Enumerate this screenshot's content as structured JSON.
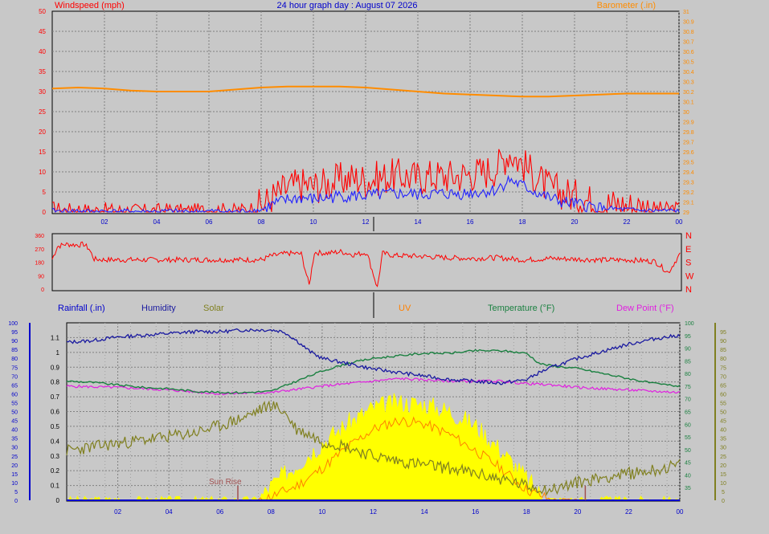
{
  "title": "24 hour graph day : August 07 2026",
  "colors": {
    "background": "#c8c8c8",
    "wind_speed": "#ff0000",
    "wind_avg": "#2222ff",
    "barometer": "#ff8c00",
    "direction": "#ff0000",
    "rainfall": "#0000cc",
    "humidity": "#1a1aa0",
    "solar": "#808020",
    "solar_fill": "#ffff00",
    "uv": "#ff8000",
    "temperature": "#1a8040",
    "dew_point": "#e020e0",
    "sun_marker": "#a05050",
    "x_ticks": "#0000cc"
  },
  "sun": {
    "rise_label": "Sun Rise",
    "rise_hour": 6.7,
    "set_hour": 20.3
  },
  "chart_data": [
    {
      "type": "line",
      "name": "wind-barometer",
      "title": "24 hour graph day : August 07 2026",
      "ylabel": "Windspeed (mph)",
      "y2label": "Barometer (.in)",
      "ylim": [
        0,
        50
      ],
      "y2lim": [
        29.0,
        31.0
      ],
      "x_ticks": [
        "02",
        "04",
        "06",
        "08",
        "10",
        "12",
        "14",
        "16",
        "18",
        "20",
        "22",
        "00"
      ],
      "x_range": [
        0,
        24
      ],
      "y_ticks": [
        "0",
        "5",
        "10",
        "15",
        "20",
        "25",
        "30",
        "35",
        "40",
        "45",
        "50"
      ],
      "y2_ticks": [
        "29",
        "29.1",
        "29.2",
        "29.3",
        "29.4",
        "29.5",
        "29.6",
        "29.7",
        "29.8",
        "29.9",
        "30",
        "30.1",
        "30.2",
        "30.3",
        "30.4",
        "30.5",
        "30.6",
        "30.7",
        "30.8",
        "30.9",
        "31"
      ],
      "grid": true,
      "series": [
        {
          "name": "Windspeed",
          "x": [
            0,
            0.5,
            1,
            1.5,
            2,
            2.5,
            3,
            3.5,
            4,
            4.5,
            5,
            5.5,
            6,
            6.5,
            7,
            7.5,
            8,
            8.5,
            9,
            9.5,
            10,
            10.5,
            11,
            11.5,
            12,
            12.5,
            13,
            13.5,
            14,
            14.5,
            15,
            15.5,
            16,
            16.5,
            17,
            17.5,
            18,
            18.5,
            19,
            19.5,
            20,
            20.5,
            21,
            21.5,
            22,
            22.5,
            23,
            23.5,
            24
          ],
          "y": [
            1,
            0.5,
            0.8,
            0.3,
            0.6,
            0.4,
            0.5,
            0.3,
            0.4,
            0.6,
            0.3,
            0.4,
            0.5,
            0.6,
            0.4,
            0.8,
            1.5,
            4,
            6,
            7,
            6.5,
            7,
            8,
            8.5,
            8,
            8.5,
            9,
            9,
            8.5,
            9,
            9,
            9,
            9.5,
            10,
            11,
            15,
            12,
            9,
            6,
            5,
            4,
            3,
            2,
            2,
            1.5,
            1.2,
            1,
            0.8,
            1
          ]
        },
        {
          "name": "Wind Average",
          "x": [
            0,
            0.5,
            1,
            1.5,
            2,
            2.5,
            3,
            3.5,
            4,
            4.5,
            5,
            5.5,
            6,
            6.5,
            7,
            7.5,
            8,
            8.5,
            9,
            9.5,
            10,
            10.5,
            11,
            11.5,
            12,
            12.5,
            13,
            13.5,
            14,
            14.5,
            15,
            15.5,
            16,
            16.5,
            17,
            17.5,
            18,
            18.5,
            19,
            19.5,
            20,
            20.5,
            21,
            21.5,
            22,
            22.5,
            23,
            23.5,
            24
          ],
          "y": [
            0.3,
            0.2,
            0.3,
            0.1,
            0.2,
            0.1,
            0.2,
            0.1,
            0.1,
            0.2,
            0.1,
            0.1,
            0.2,
            0.2,
            0.1,
            0.3,
            0.5,
            2,
            3,
            3.5,
            3.2,
            3.5,
            4,
            4,
            4,
            4.2,
            4.5,
            4.5,
            4.3,
            4.5,
            4.5,
            4.5,
            4.8,
            5,
            5.5,
            8,
            6.5,
            5,
            3.5,
            2.5,
            2,
            1.5,
            1,
            0.8,
            0.6,
            0.4,
            0.3,
            0.3,
            0.3
          ]
        },
        {
          "name": "Barometer",
          "axis": "right",
          "x": [
            0,
            1,
            2,
            3,
            4,
            5,
            6,
            7,
            8,
            9,
            10,
            11,
            12,
            13,
            14,
            15,
            16,
            17,
            18,
            19,
            20,
            21,
            22,
            23,
            24
          ],
          "y": [
            30.23,
            30.24,
            30.23,
            30.21,
            30.2,
            30.2,
            30.2,
            30.22,
            30.24,
            30.25,
            30.25,
            30.25,
            30.24,
            30.22,
            30.2,
            30.18,
            30.17,
            30.16,
            30.15,
            30.15,
            30.16,
            30.17,
            30.18,
            30.18,
            30.18
          ]
        }
      ]
    },
    {
      "type": "line",
      "name": "wind-direction",
      "ylim": [
        0,
        360
      ],
      "y_ticks": [
        "0",
        "90",
        "180",
        "270",
        "360"
      ],
      "direction_labels": [
        "N",
        "W",
        "S",
        "E",
        "N"
      ],
      "x_range": [
        0,
        24
      ],
      "grid": false,
      "series": [
        {
          "name": "Wind Direction",
          "x": [
            0,
            0.2,
            0.5,
            1,
            1.2,
            1.4,
            1.6,
            2,
            4,
            6,
            8,
            8.3,
            9,
            9.5,
            9.8,
            10,
            10.5,
            11,
            11.5,
            12,
            12.4,
            12.6,
            13,
            14,
            15,
            16,
            17,
            18,
            19,
            20,
            21,
            22,
            23,
            23.5,
            24
          ],
          "y": [
            200,
            285,
            300,
            295,
            300,
            270,
            200,
            196,
            196,
            196,
            196,
            220,
            240,
            235,
            25,
            245,
            240,
            250,
            230,
            245,
            10,
            240,
            225,
            220,
            210,
            205,
            210,
            195,
            205,
            200,
            195,
            195,
            185,
            110,
            250
          ]
        }
      ]
    },
    {
      "type": "line",
      "name": "weather-combo",
      "labels": [
        "Rainfall (.in)",
        "Humidity",
        "Solar",
        "UV",
        "Temperature (°F)",
        "Dew Point (°F)"
      ],
      "x_ticks": [
        "02",
        "04",
        "06",
        "08",
        "10",
        "12",
        "14",
        "16",
        "18",
        "20",
        "22",
        "00"
      ],
      "x_range": [
        0,
        24
      ],
      "rain_ticks": [
        "0",
        "0.1",
        "0.2",
        "0.3",
        "0.4",
        "0.5",
        "0.6",
        "0.7",
        "0.8",
        "0.9",
        "1",
        "1.1"
      ],
      "rain_lim": [
        0,
        1.2
      ],
      "hum_ticks": [
        "0",
        "5",
        "10",
        "15",
        "20",
        "25",
        "30",
        "35",
        "40",
        "45",
        "50",
        "55",
        "60",
        "65",
        "70",
        "75",
        "80",
        "85",
        "90",
        "95",
        "100"
      ],
      "hum_lim": [
        0,
        100
      ],
      "temp_ticks": [
        "35",
        "40",
        "45",
        "50",
        "55",
        "60",
        "65",
        "70",
        "75",
        "80",
        "85",
        "90",
        "95",
        "100"
      ],
      "temp_lim": [
        30,
        100
      ],
      "uv_ticks": [
        "0",
        "5",
        "10",
        "15",
        "20",
        "25",
        "30",
        "35",
        "40",
        "45",
        "50",
        "55",
        "60",
        "65",
        "70",
        "75",
        "80",
        "85",
        "90",
        "95"
      ],
      "uv_lim": [
        0,
        100
      ],
      "grid": true,
      "series": [
        {
          "name": "Humidity",
          "axis": "hum",
          "x": [
            0,
            1,
            2,
            3,
            4,
            5,
            6,
            7,
            8,
            8.5,
            9,
            9.5,
            10,
            11,
            12,
            13,
            14,
            15,
            16,
            17,
            17.5,
            18,
            18.5,
            19,
            20,
            21,
            22,
            23,
            24
          ],
          "y": [
            89,
            90,
            92,
            93,
            94,
            95,
            95,
            96,
            96,
            95,
            90,
            84,
            80,
            77,
            74,
            72,
            70,
            68,
            67,
            66,
            67,
            68,
            72,
            75,
            80,
            84,
            88,
            91,
            93
          ]
        },
        {
          "name": "Temperature",
          "axis": "temp",
          "x": [
            0,
            1,
            2,
            3,
            4,
            5,
            6,
            7,
            8,
            9,
            10,
            11,
            12,
            13,
            14,
            15,
            16,
            17,
            18,
            18.5,
            19,
            20,
            21,
            22,
            23,
            24
          ],
          "y": [
            77,
            76.5,
            75.5,
            74.5,
            74,
            73,
            72.5,
            72.5,
            73,
            77,
            81,
            84,
            86,
            87,
            88,
            88,
            89,
            89,
            88,
            84,
            83,
            82,
            80,
            78,
            76,
            75
          ]
        },
        {
          "name": "Dew Point",
          "axis": "temp",
          "x": [
            0,
            2,
            4,
            6,
            8,
            10,
            12,
            13,
            14,
            15,
            16,
            17,
            18,
            19,
            20,
            22,
            24
          ],
          "y": [
            75,
            74.5,
            73.5,
            72,
            72.5,
            75,
            77,
            78,
            77.5,
            77,
            77,
            77,
            76,
            75.5,
            74.5,
            73.5,
            72.5
          ]
        },
        {
          "name": "Solar",
          "axis": "uv",
          "x": [
            0,
            1,
            2,
            3,
            4,
            5,
            6,
            7,
            8,
            8.5,
            9,
            9.5,
            10,
            10.5,
            11,
            12,
            13,
            14,
            15,
            16,
            17,
            18,
            19,
            20,
            21,
            22,
            23,
            24
          ],
          "y": [
            28,
            30,
            32,
            34,
            36,
            38,
            42,
            47,
            54,
            50,
            40,
            37,
            33,
            32,
            30,
            25,
            22,
            20,
            18,
            15,
            12,
            8,
            6,
            10,
            13,
            15,
            17,
            20
          ]
        },
        {
          "name": "UV",
          "axis": "uv",
          "x": [
            7.5,
            8,
            9,
            10,
            11,
            12,
            13,
            14,
            15,
            16,
            17,
            18,
            19,
            20
          ],
          "y": [
            0,
            2,
            8,
            18,
            30,
            40,
            45,
            43,
            37,
            28,
            18,
            6,
            0,
            0
          ]
        },
        {
          "name": "Solar Radiation",
          "axis": "uv",
          "x": [
            0,
            7.5,
            8,
            9,
            10,
            11,
            12,
            13,
            14,
            15,
            16,
            17,
            17.5,
            18,
            18.5,
            19,
            24
          ],
          "y": [
            0,
            0,
            8,
            20,
            32,
            43,
            52,
            55,
            54,
            50,
            42,
            28,
            20,
            12,
            4,
            0,
            0
          ]
        },
        {
          "name": "Rainfall",
          "axis": "rain",
          "x": [
            0,
            24
          ],
          "y": [
            0,
            0
          ]
        }
      ]
    }
  ]
}
